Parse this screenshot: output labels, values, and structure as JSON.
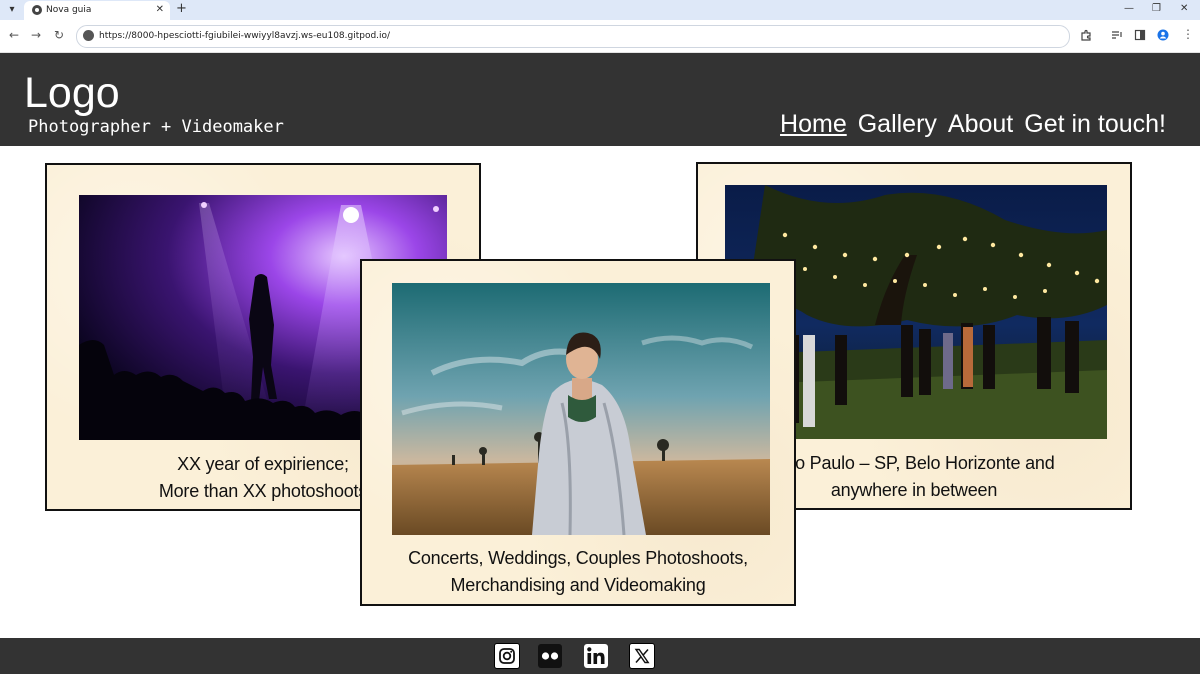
{
  "browser": {
    "tab_title": "Nova guia",
    "url": "https://8000-hpesciotti-fgiubilei-wwiyyl8avzj.ws-eu108.gitpod.io/"
  },
  "header": {
    "logo": "Logo",
    "tagline": "Photographer + Videomaker",
    "nav": [
      "Home",
      "Gallery",
      "About",
      "Get in touch!"
    ]
  },
  "cards": [
    {
      "caption_line1": "XX year of expirience;",
      "caption_line2": "More than XX photoshoots"
    },
    {
      "caption_line1": "Concerts, Weddings, Couples Photoshoots,",
      "caption_line2": "Merchandising and Videomaking"
    },
    {
      "caption_line1": "São Paulo – SP, Belo Horizonte and",
      "caption_line2": "anywhere in between"
    }
  ],
  "footer": {
    "social": [
      "instagram-icon",
      "flickr-icon",
      "linkedin-icon",
      "x-icon"
    ]
  },
  "colors": {
    "header_bg": "#333333",
    "card_bg": "#fbf0d8",
    "text_dark": "#111111"
  }
}
